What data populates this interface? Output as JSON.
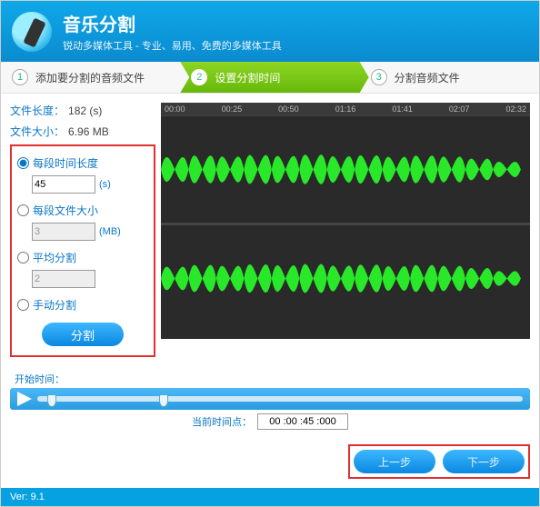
{
  "header": {
    "title": "音乐分割",
    "subtitle": "锐动多媒体工具 - 专业、易用、免费的多媒体工具"
  },
  "steps": [
    {
      "num": "1",
      "label": "添加要分割的音频文件"
    },
    {
      "num": "2",
      "label": "设置分割时间"
    },
    {
      "num": "3",
      "label": "分割音频文件"
    }
  ],
  "info": {
    "len_label": "文件长度：",
    "len_value": "182 (s)",
    "size_label": "文件大小：",
    "size_value": "6.96 MB"
  },
  "opts": {
    "by_time": {
      "label": "每段时间长度",
      "value": "45",
      "unit": "(s)"
    },
    "by_size": {
      "label": "每段文件大小",
      "value": "3",
      "unit": "(MB)"
    },
    "avg": {
      "label": "平均分割",
      "value": "2"
    },
    "manual": {
      "label": "手动分割"
    },
    "split_btn": "分割"
  },
  "ruler": [
    "00:00",
    "00:25",
    "00:50",
    "01:16",
    "01:41",
    "02:07",
    "02:32"
  ],
  "timeline": {
    "start_label": "开始时间：",
    "current_label": "当前时间点：",
    "current_value": "00 :00 :45 :000"
  },
  "nav": {
    "prev": "上一步",
    "next": "下一步"
  },
  "footer": {
    "version_label": "Ver: ",
    "version": "9.1"
  }
}
